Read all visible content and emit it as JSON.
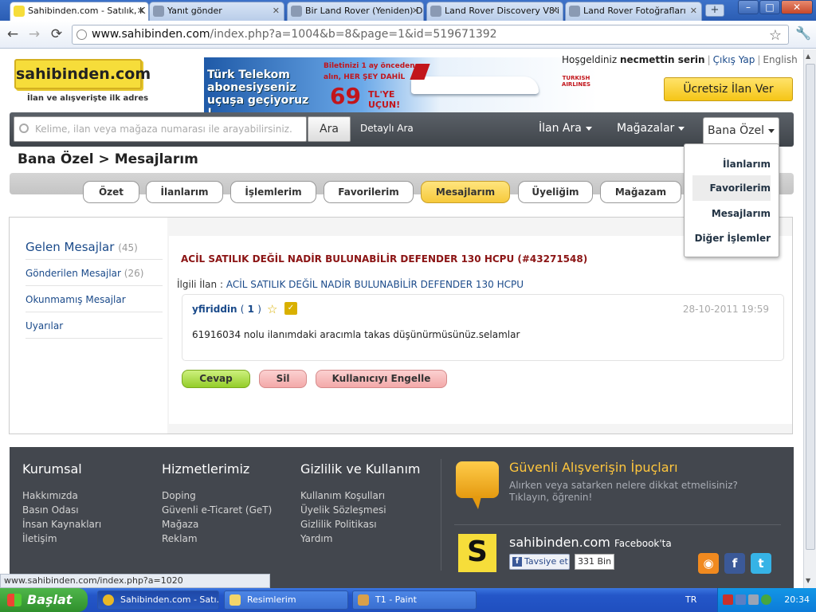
{
  "browser": {
    "tabs": [
      {
        "title": "Sahibinden.com - Satılık, K",
        "active": true
      },
      {
        "title": "Yanıt gönder",
        "active": false
      },
      {
        "title": "Bir Land Rover (Yeniden) D",
        "active": false
      },
      {
        "title": "Land Rover Discovery V8'i",
        "active": false
      },
      {
        "title": "Land Rover Fotoğrafları",
        "active": false
      }
    ],
    "url_host": "www.sahibinden.com",
    "url_path": "/index.php?a=1004&b=8&page=1&id=519671392",
    "status_url": "www.sahibinden.com/index.php?a=1020",
    "new_tab": "+",
    "win_min": "–",
    "win_max": "□",
    "win_close": "✕",
    "back": "←",
    "forward": "→",
    "reload": "⟳",
    "star": "☆",
    "wrench": "🔧"
  },
  "header": {
    "logo": "sahibinden.com",
    "slogan": "İlan ve alışverişte ilk adres",
    "welcome_prefix": "Hoşgeldiniz",
    "username": "necmettin serin",
    "logout": "Çıkış Yap",
    "language": "English",
    "free_listing": "Ücretsiz İlan Ver"
  },
  "ad": {
    "line1": "Türk Telekom abonesiyseniz uçuşa geçiyoruz !",
    "line2": "Biletinizi 1 ay önceden alın, HER ŞEY DAHİL",
    "price": "69",
    "price_suffix": "TL'YE UÇUN!",
    "airline": "TURKISH AIRLINES"
  },
  "search": {
    "placeholder": "Kelime, ilan veya mağaza numarası ile arayabilirsiniz.",
    "button": "Ara",
    "advanced": "Detaylı Ara"
  },
  "nav": {
    "ilan_ara": "İlan Ara",
    "magazalar": "Mağazalar",
    "bana_ozel": "Bana Özel"
  },
  "dropdown": {
    "items": [
      "İlanlarım",
      "Favorilerim",
      "Mesajlarım",
      "Diğer İşlemler"
    ],
    "highlighted": "Favorilerim"
  },
  "breadcrumb": "Bana Özel > Mesajlarım",
  "page_tabs": [
    {
      "label": "Özet",
      "active": false
    },
    {
      "label": "İlanlarım",
      "active": false
    },
    {
      "label": "İşlemlerim",
      "active": false
    },
    {
      "label": "Favorilerim",
      "active": false
    },
    {
      "label": "Mesajlarım",
      "active": true
    },
    {
      "label": "Üyeliğim",
      "active": false
    },
    {
      "label": "Mağazam",
      "active": false
    }
  ],
  "sidebar": {
    "items": [
      {
        "label": "Gelen Mesajlar",
        "count": "(45)"
      },
      {
        "label": "Gönderilen Mesajlar",
        "count": "(26)"
      },
      {
        "label": "Okunmamış Mesajlar",
        "count": ""
      },
      {
        "label": "Uyarılar",
        "count": ""
      }
    ]
  },
  "message": {
    "title": "ACİL SATILIK DEĞİL NADİR BULUNABİLİR DEFENDER 130 HCPU (#43271548)",
    "related_label": "İlgili İlan :",
    "related_link": "ACİL SATILIK DEĞİL NADİR BULUNABİLİR DEFENDER 130 HCPU",
    "sender": "yfiriddin",
    "sender_score_open": "(",
    "sender_score": "1",
    "sender_score_close": ")",
    "date": "28-10-2011 19:59",
    "body": "61916034 nolu ilanımdaki aracımla takas düşünürmüsünüz.selamlar",
    "reply": "Cevap",
    "delete": "Sil",
    "block": "Kullanıcıyı Engelle"
  },
  "footer": {
    "col1": {
      "title": "Kurumsal",
      "links": [
        "Hakkımızda",
        "Basın Odası",
        "İnsan Kaynakları",
        "İletişim"
      ]
    },
    "col2": {
      "title": "Hizmetlerimiz",
      "links": [
        "Doping",
        "Güvenli e-Ticaret (GeT)",
        "Mağaza",
        "Reklam"
      ]
    },
    "col3": {
      "title": "Gizlilik ve Kullanım",
      "links": [
        "Kullanım Koşulları",
        "Üyelik Sözleşmesi",
        "Gizlilik Politikası",
        "Yardım"
      ]
    },
    "tips_title": "Güvenli Alışverişin İpuçları",
    "tips_sub": "Alırken veya satarken nelere dikkat etmelisiniz? Tıklayın, öğrenin!",
    "brand": "sahibinden.com",
    "brand_suffix": "Facebook'ta",
    "s_icon": "S",
    "like": "Tavsiye et",
    "like_count": "331 Bin"
  },
  "taskbar": {
    "start": "Başlat",
    "tasks": [
      "Sahibinden.com - Satı...",
      "Resimlerim",
      "T1 - Paint"
    ],
    "lang": "TR",
    "clock": "20:34"
  },
  "colors": {
    "brand_yellow": "#f6dd3a",
    "tab_active": "#f6c93b",
    "footer_bg": "#43474e",
    "accent_link": "#1a4a8a",
    "title_red": "#8b1414"
  }
}
